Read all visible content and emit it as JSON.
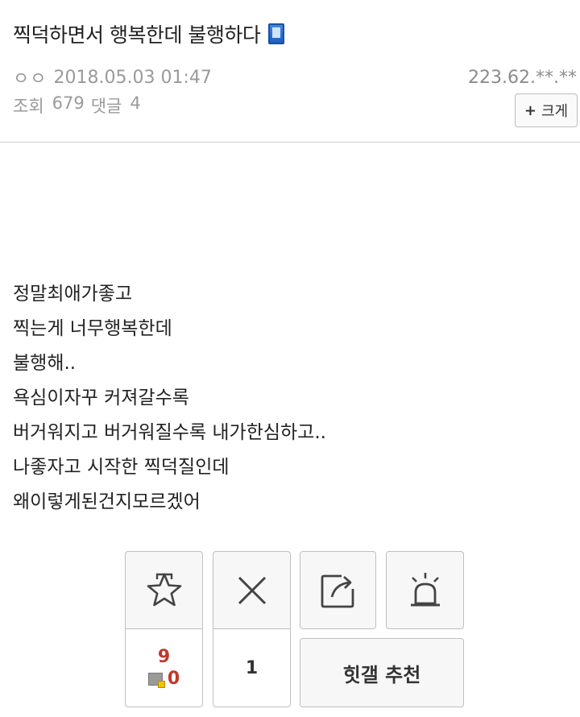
{
  "post": {
    "title": "찍덕하면서 행복한데 불행하다",
    "author": "ㅇㅇ",
    "datetime": "2018.05.03 01:47",
    "ip": "223.62.**.**",
    "views_label": "조회",
    "views": "679",
    "comments_label": "댓글",
    "comments": "4",
    "enlarge_label": "크게",
    "body_lines": [
      "정말최애가좋고",
      "찍는게 너무행복한데",
      "불행해..",
      "욕심이자꾸 커져갈수록",
      "버거워지고 버거워질수록 내가한심하고..",
      "나좋자고 시작한 찍덕질인데",
      "왜이렇게된건지모르겠어"
    ]
  },
  "actions": {
    "scrap_count": "9",
    "fix_count": "0",
    "nope_count": "1",
    "recommend_label": "힛갤 추천"
  },
  "icons": {
    "title_icon": "mobile-icon",
    "scrap": "star-icon",
    "nope": "x-icon",
    "share": "share-icon",
    "report": "siren-icon"
  }
}
